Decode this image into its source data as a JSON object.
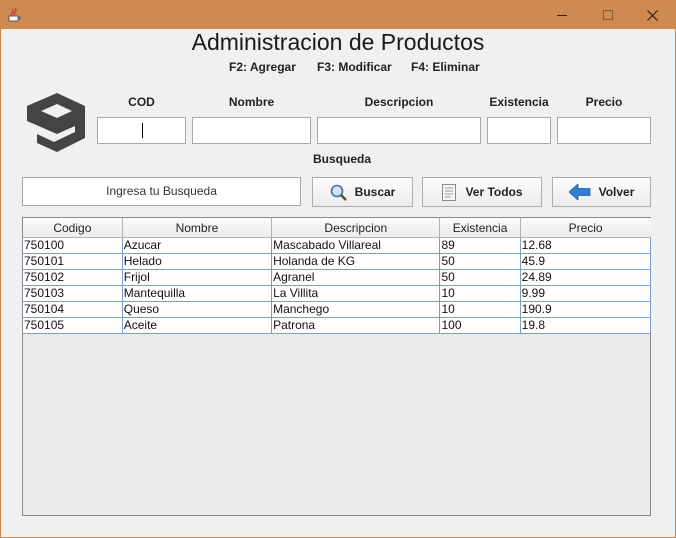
{
  "window": {
    "title": "",
    "controls": [
      "minimize-icon",
      "maximize-icon",
      "close-icon"
    ]
  },
  "header": {
    "title": "Administracion de Productos",
    "shortcuts": [
      "F2: Agregar",
      "F3: Modificar",
      "F4: Eliminar"
    ]
  },
  "logo": {
    "icon": "nine-logo-icon"
  },
  "form": {
    "labels": {
      "cod": "COD",
      "nombre": "Nombre",
      "descripcion": "Descripcion",
      "existencia": "Existencia",
      "precio": "Precio"
    },
    "values": {
      "cod": "",
      "nombre": "",
      "descripcion": "",
      "existencia": "",
      "precio": ""
    }
  },
  "search": {
    "label": "Busqueda",
    "value": "Ingresa tu Busqueda"
  },
  "buttons": {
    "buscar": "Buscar",
    "ver_todos": "Ver Todos",
    "volver": "Volver"
  },
  "table": {
    "columns": [
      "Codigo",
      "Nombre",
      "Descripcion",
      "Existencia",
      "Precio"
    ],
    "rows": [
      [
        "750100",
        "Azucar",
        "Mascabado Villareal",
        "89",
        "12.68"
      ],
      [
        "750101",
        "Helado",
        "Holanda de KG",
        "50",
        "45.9"
      ],
      [
        "750102",
        "Frijol",
        "Agranel",
        "50",
        "24.89"
      ],
      [
        "750103",
        "Mantequilla",
        "La Villita",
        "10",
        "9.99"
      ],
      [
        "750104",
        "Queso",
        "Manchego",
        "10",
        "190.9"
      ],
      [
        "750105",
        "Aceite",
        "Patrona",
        "100",
        "19.8"
      ]
    ]
  },
  "colors": {
    "titlebar": "#ce8a50",
    "background": "#f0f0f0",
    "grid": "#7e9dc4"
  }
}
